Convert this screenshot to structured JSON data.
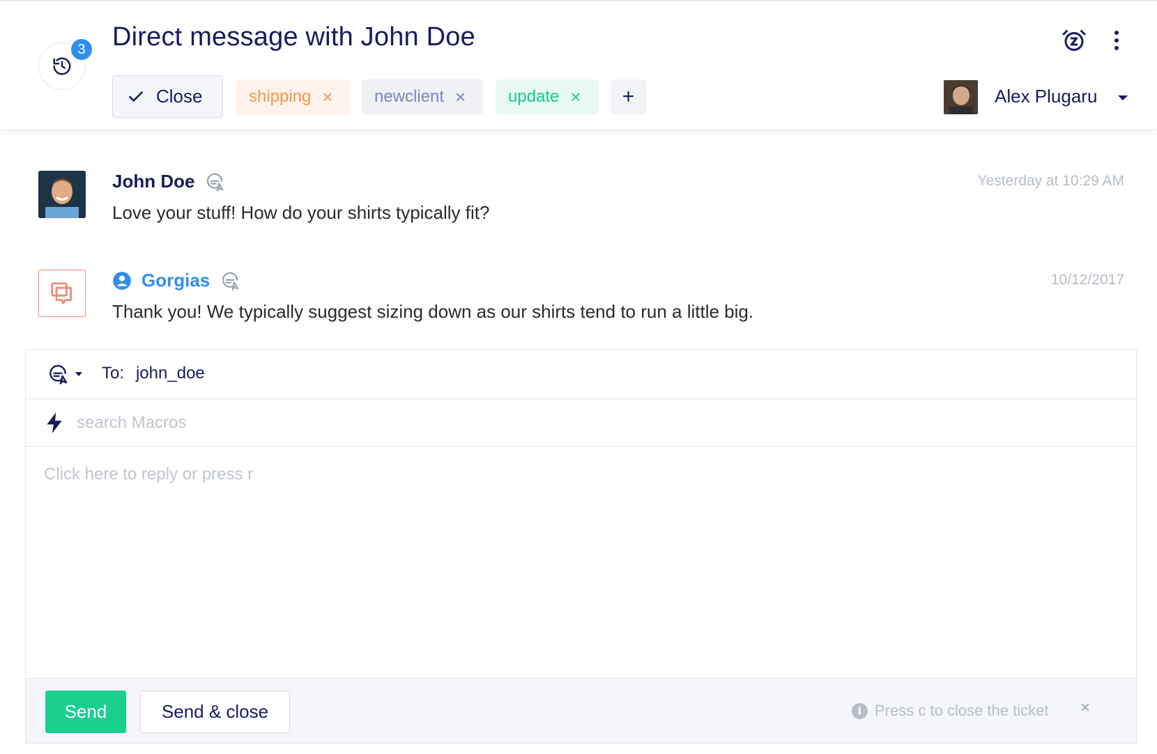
{
  "header": {
    "title": "Direct message with John Doe",
    "history_count": "3",
    "close_label": "Close",
    "tags": [
      {
        "label": "shipping",
        "color": "#f5964b"
      },
      {
        "label": "newclient",
        "color": "#7c84bf"
      },
      {
        "label": "update",
        "color": "#17c98f"
      }
    ],
    "add_tag_label": "+",
    "assignee": "Alex Plugaru",
    "icons": [
      "history-icon",
      "snooze-icon",
      "more-vertical-icon",
      "check-icon",
      "chevron-down-icon"
    ]
  },
  "messages": [
    {
      "author": "John Doe",
      "time": "Yesterday at 10:29 AM",
      "body": "Love your stuff! How do your shirts typically fit?"
    },
    {
      "author": "Gorgias",
      "time": "10/12/2017",
      "body": "Thank you! We typically suggest sizing down as our shirts tend to run a little big."
    }
  ],
  "composer": {
    "to_label": "To:",
    "to_value": "john_doe",
    "macro_placeholder": "search Macros",
    "reply_placeholder": "Click here to reply or press r",
    "send_label": "Send",
    "send_close_label": "Send & close",
    "hint": "Press c to close the ticket",
    "hint_close": "×"
  },
  "colors": {
    "primary_text": "#1a1a5e",
    "accent_blue": "#2f8ef0",
    "send_green": "#1bcf8f",
    "gorgias_orange": "#f08a78"
  }
}
